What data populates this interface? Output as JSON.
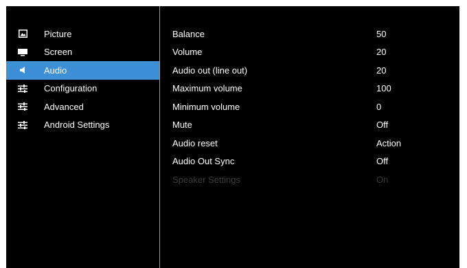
{
  "menu": {
    "items": [
      {
        "label": "Picture",
        "icon": "picture-icon"
      },
      {
        "label": "Screen",
        "icon": "screen-icon"
      },
      {
        "label": "Audio",
        "icon": "speaker-icon",
        "active": true
      },
      {
        "label": "Configuration",
        "icon": "sliders-icon"
      },
      {
        "label": "Advanced",
        "icon": "sliders-icon"
      },
      {
        "label": "Android Settings",
        "icon": "sliders-icon"
      }
    ]
  },
  "settings": {
    "rows": [
      {
        "label": "Balance",
        "value": "50"
      },
      {
        "label": "Volume",
        "value": "20"
      },
      {
        "label": "Audio out (line out)",
        "value": "20"
      },
      {
        "label": "Maximum volume",
        "value": "100"
      },
      {
        "label": "Minimum volume",
        "value": "0"
      },
      {
        "label": "Mute",
        "value": "Off"
      },
      {
        "label": "Audio reset",
        "value": "Action"
      },
      {
        "label": "Audio Out Sync",
        "value": "Off"
      },
      {
        "label": "Speaker Settings",
        "value": "On",
        "disabled": true
      }
    ]
  },
  "colors": {
    "background": "#000000",
    "highlight": "#3d8fd6",
    "text": "#ffffff",
    "disabled_text": "#3c3c3c",
    "divider": "#9a9a9a"
  }
}
